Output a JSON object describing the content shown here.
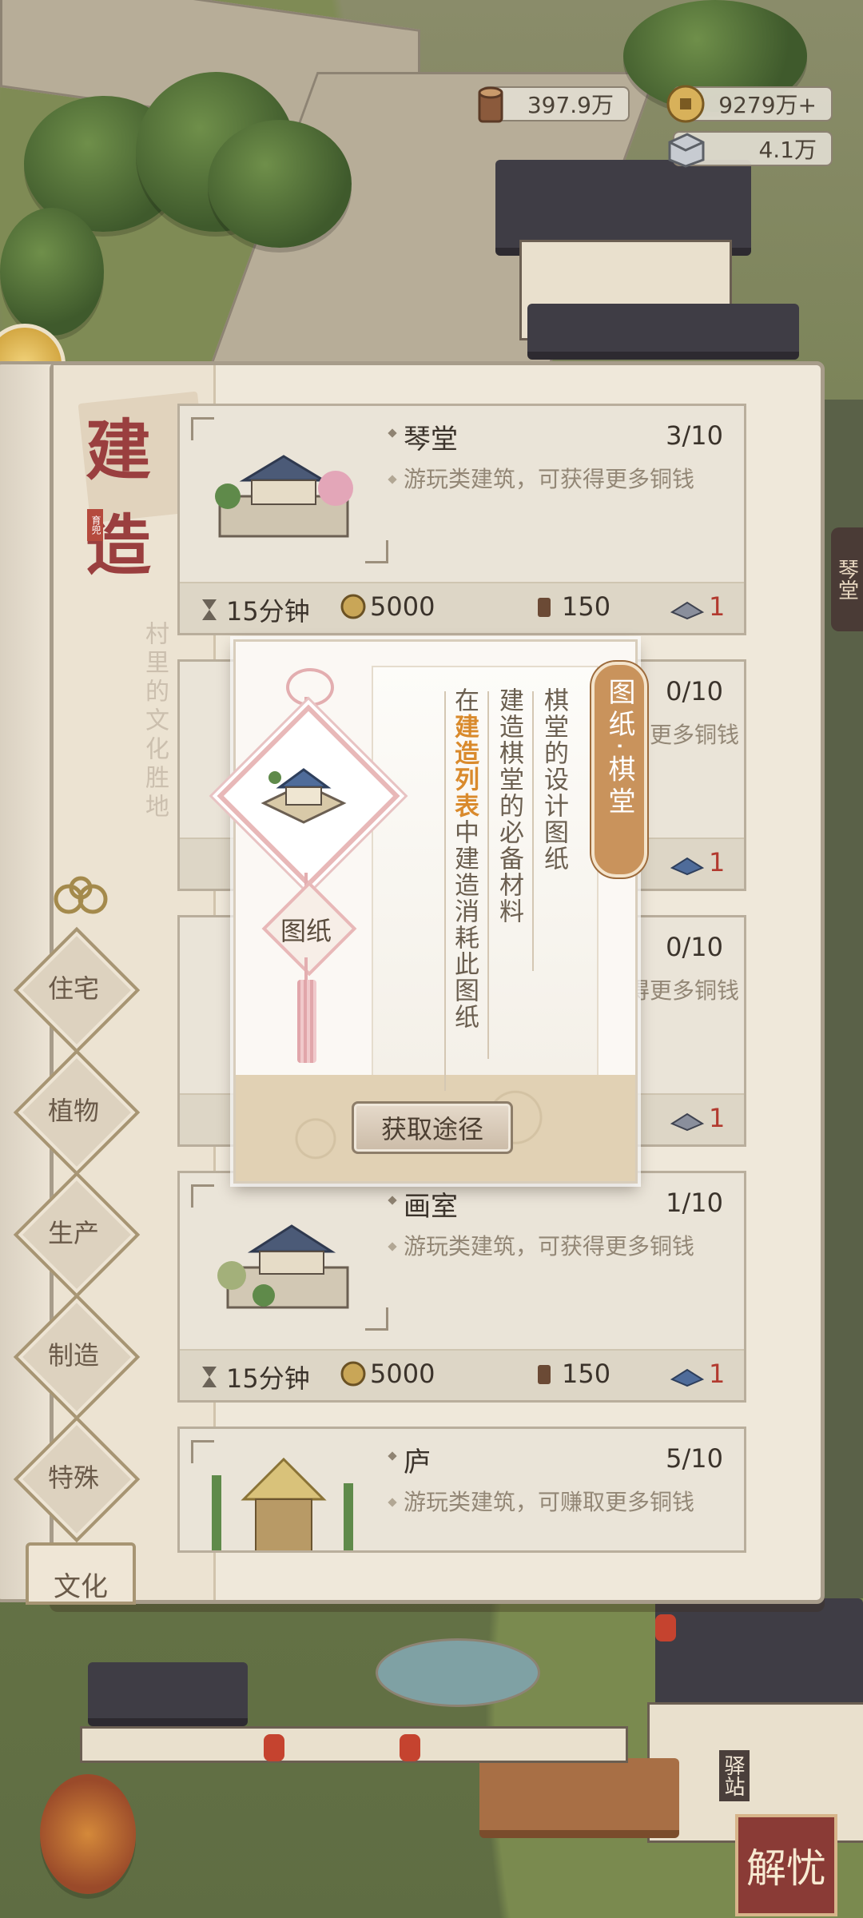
{
  "resources": [
    {
      "name": "wood",
      "icon": "wood-log-icon",
      "value": "397.9万"
    },
    {
      "name": "copper",
      "icon": "copper-coin-icon",
      "value": "9279万+"
    },
    {
      "name": "stone",
      "icon": "stone-block-icon",
      "value": "4.1万"
    }
  ],
  "panel": {
    "title": "建造",
    "subtitle": "村里的文化胜地",
    "seal": "育兜"
  },
  "categories": [
    "住宅",
    "植物",
    "生产",
    "制造",
    "特殊",
    "文化"
  ],
  "cards": [
    {
      "name": "琴堂",
      "count": "3/10",
      "desc": "游玩类建筑，可获得更多铜钱",
      "time": "15分钟",
      "coins": "5000",
      "wood": "150",
      "blueprint": "1"
    },
    {
      "name": "棋堂",
      "count": "0/10",
      "desc": "游玩类建筑，可获得更多铜钱",
      "blueprint": "1"
    },
    {
      "name": "",
      "count": "0/10",
      "desc": "游玩类建筑，可获得更多铜钱",
      "blueprint": "1"
    },
    {
      "name": "画室",
      "count": "1/10",
      "desc": "游玩类建筑，可获得更多铜钱",
      "time": "15分钟",
      "coins": "5000",
      "wood": "150",
      "blueprint": "1"
    },
    {
      "name": "庐",
      "count": "5/10",
      "desc": "游玩类建筑，可赚取更多铜钱"
    }
  ],
  "popup": {
    "tag": "图纸·棋堂",
    "col1": "棋堂的设计图纸",
    "col2": "建造棋堂的必备材料",
    "col3_pre": "在",
    "col3_hl": "建造列表",
    "col3_post": "中建造消耗此图纸",
    "item_label": "图纸",
    "button": "获取途径"
  },
  "side": {
    "right_tab": "琴堂",
    "station": "驿站",
    "jieyou": "解忧"
  },
  "colors": {
    "accent": "#c9935c",
    "highlight": "#d98a2c",
    "blueprint_red": "#b23a2f"
  }
}
